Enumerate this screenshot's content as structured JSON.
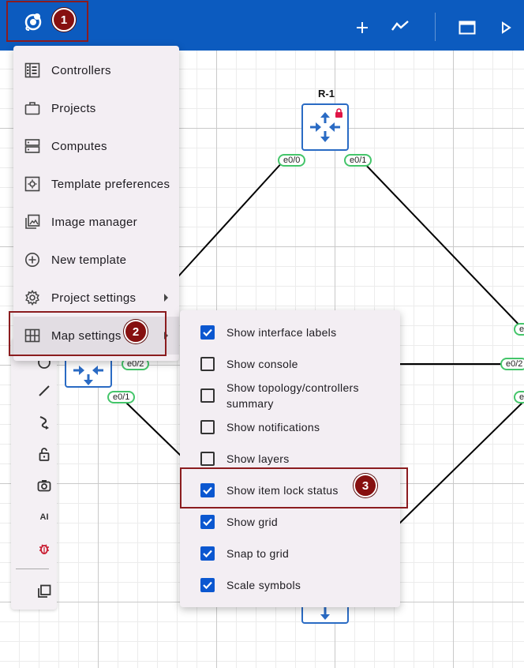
{
  "toolbar": {
    "logo_icon": "gns3-logo-icon",
    "actions": [
      "add-icon",
      "trend-icon",
      "window-icon",
      "play-icon"
    ]
  },
  "annotations": {
    "badge1": "1",
    "badge2": "2",
    "badge3": "3"
  },
  "topology": {
    "router_label": "R-1",
    "interfaces": {
      "r1_left": "e0/0",
      "r1_right": "e0/1",
      "right_top": "e",
      "mid_left": "e0/2",
      "right_mid": "e0/2",
      "bottom_left": "e0/1",
      "right_low": "e"
    }
  },
  "main_menu": {
    "items": [
      {
        "label": "Controllers",
        "icon": "controllers-icon"
      },
      {
        "label": "Projects",
        "icon": "briefcase-icon"
      },
      {
        "label": "Computes",
        "icon": "server-icon"
      },
      {
        "label": "Template preferences",
        "icon": "template-settings-icon"
      },
      {
        "label": "Image manager",
        "icon": "image-icon"
      },
      {
        "label": "New template",
        "icon": "add-circle-icon"
      },
      {
        "label": "Project settings",
        "icon": "gear-icon"
      },
      {
        "label": "Map settings",
        "icon": "grid-icon"
      }
    ]
  },
  "map_settings": {
    "items": [
      {
        "label": "Show interface labels",
        "checked": true
      },
      {
        "label": "Show console",
        "checked": false
      },
      {
        "label": "Show topology/controllers summary",
        "checked": false
      },
      {
        "label": "Show notifications",
        "checked": false
      },
      {
        "label": "Show layers",
        "checked": false
      },
      {
        "label": "Show item lock status",
        "checked": true
      },
      {
        "label": "Show grid",
        "checked": true
      },
      {
        "label": "Snap to grid",
        "checked": true
      },
      {
        "label": "Scale symbols",
        "checked": true
      }
    ]
  },
  "side_toolbar": {
    "tools": [
      "ellipse-icon",
      "line-icon",
      "curve-icon",
      "lock-icon",
      "camera-icon",
      "ai-icon",
      "bug-icon",
      "copy-icon"
    ],
    "ai_label": "AI"
  },
  "colors": {
    "topbar": "#0c5bbf",
    "highlight": "#8b1c1f",
    "checkbox": "#0b57d0",
    "interface_border": "#44c56a"
  }
}
